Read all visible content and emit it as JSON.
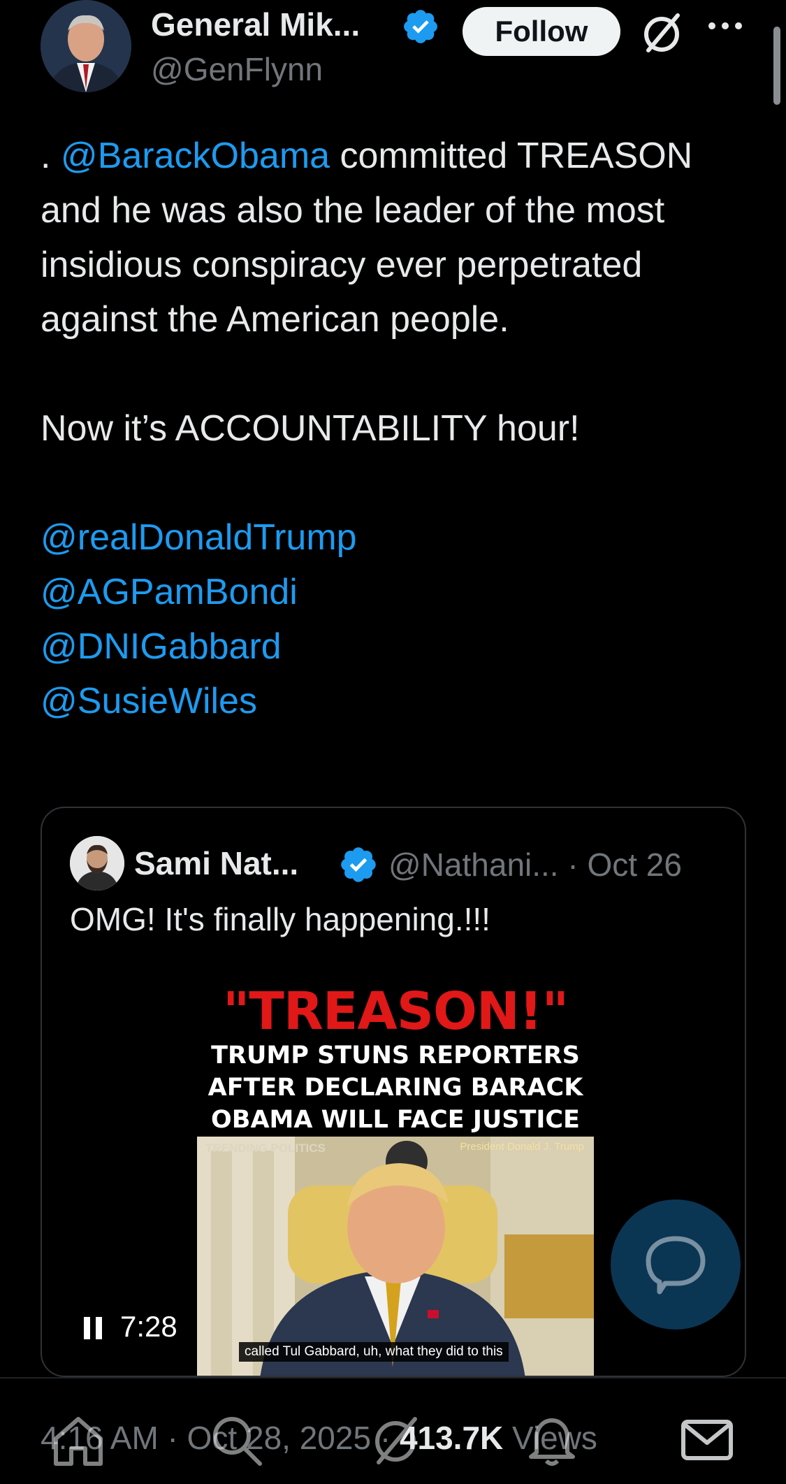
{
  "author": {
    "name": "General Mik...",
    "handle": "@GenFlynn",
    "verified": true
  },
  "header": {
    "follow_label": "Follow",
    "grok_icon": "grok-icon",
    "more_icon": "more-icon"
  },
  "tweet": {
    "lead": ". ",
    "mention_1": "@BarackObama",
    "text_1": " committed TREASON and he was also the leader of the most insidious conspiracy ever perpetrated against the American people.",
    "text_2": "Now it’s ACCOUNTABILITY hour!",
    "mentions": [
      "@realDonaldTrump",
      "@AGPamBondi",
      "@DNIGabbard",
      "@SusieWiles"
    ]
  },
  "quote": {
    "name": "Sami Nat...",
    "handle_date": "@Nathani... · Oct 26",
    "text": "OMG! It's finally happening.!!!",
    "media": {
      "title": "\"TREASON!\"",
      "line_1": "TRUMP STUNS REPORTERS",
      "line_2": "AFTER DECLARING BARACK",
      "line_3": "OBAMA WILL FACE JUSTICE",
      "trending": "TRENDING POLITICS",
      "president": "President Donald J. Trump",
      "caption": "called Tul Gabbard, uh, what they did to this"
    },
    "video_time": "7:28"
  },
  "meta": {
    "time": "4:16 AM · Oct 28, 2025 · ",
    "views_count": "413.7K",
    "views_label": " Views"
  },
  "bottom_nav": [
    "home-icon",
    "search-icon",
    "grok-icon",
    "notifications-icon",
    "messages-icon"
  ],
  "colors": {
    "background": "#000000",
    "link": "#1d9bf0",
    "muted": "#71767b",
    "verified": "#1d9bf0",
    "treason_red": "#e01818"
  }
}
